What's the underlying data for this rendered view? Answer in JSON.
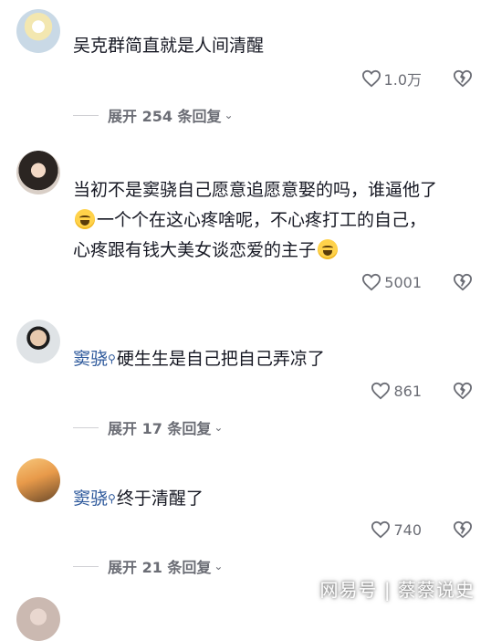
{
  "comments": [
    {
      "lines": [
        "吴克群简直就是人间清醒"
      ],
      "likes": "1.0万",
      "replies": "展开 254 条回复"
    },
    {
      "lines": [
        "当初不是窦骁自己愿意追愿意娶的吗，谁逼他了",
        "一个个在这心疼啥呢，不心疼打工的自己，",
        "心疼跟有钱大美女谈恋爱的主子"
      ],
      "likes": "5001"
    },
    {
      "name": "窦骁",
      "text": "硬生生是自己把自己弄凉了",
      "likes": "861",
      "replies": "展开 17 条回复"
    },
    {
      "name": "窦骁",
      "text": "终于清醒了",
      "likes": "740",
      "replies": "展开 21 条回复"
    }
  ],
  "watermark": "网易号 | 蔡蔡说史",
  "icons": {
    "like": "heart-outline-icon",
    "dislike": "broken-heart-icon",
    "search_mark": "search-icon",
    "emoji": "grinning-sweat-emoji-icon",
    "chevron": "chevron-down-icon"
  }
}
